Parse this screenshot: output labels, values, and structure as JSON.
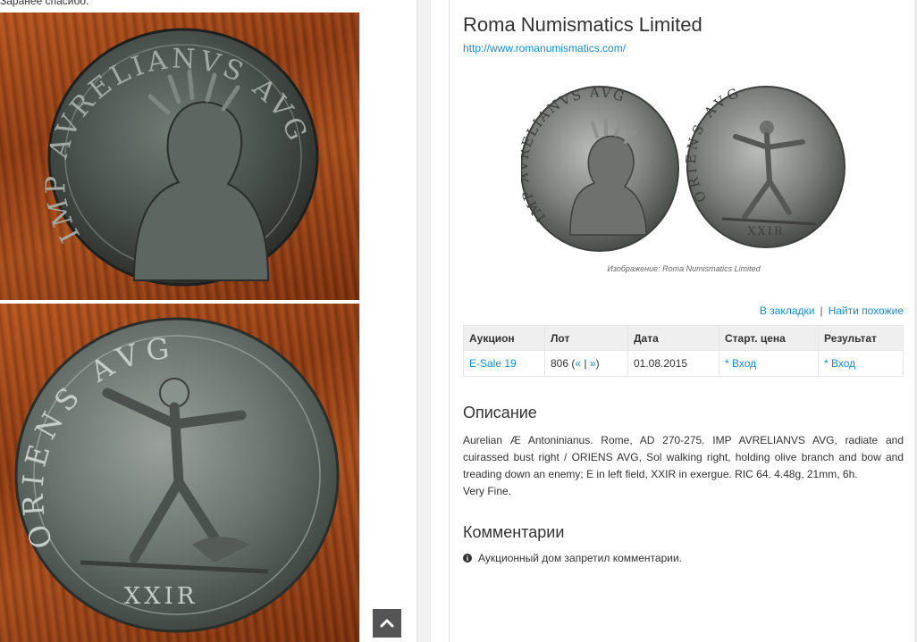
{
  "left": {
    "top_text": "Заранее спасибо.",
    "photo_obverse_legend": "IMP AVRELIANVS AVG",
    "photo_reverse_legend": "ORIENS AVG",
    "photo_reverse_exergue": "XXIR"
  },
  "header": {
    "title": "Roma Numismatics Limited",
    "url": "http://www.romanumismatics.com/"
  },
  "image": {
    "caption": "Изображение: Roma Numismatics Limited"
  },
  "actions": {
    "bookmarks": "В закладки",
    "separator": "|",
    "find_similar": "Найти похожие"
  },
  "table": {
    "headers": [
      "Аукцион",
      "Лот",
      "Дата",
      "Старт. цена",
      "Результат"
    ],
    "row": {
      "auction": "E-Sale 19",
      "lot": "806",
      "lot_prev": "«",
      "lot_sep": "|",
      "lot_next": "»",
      "date": "01.08.2015",
      "start_price": "* Вход",
      "result": "* Вход"
    }
  },
  "description": {
    "heading": "Описание",
    "text": "Aurelian Æ Antoninianus. Rome, AD 270-275. IMP AVRELIANVS AVG, radiate and cuirassed bust right / ORIENS AVG, Sol walking right, holding olive branch and bow and treading down an enemy; E in left field, XXIR in exergue. RIC 64. 4.48g, 21mm, 6h.",
    "grade": "Very Fine."
  },
  "comments": {
    "heading": "Комментарии",
    "note": "Аукционный дом запретил комментарии."
  },
  "icons": {
    "scroll_top": "chevron-up-icon",
    "info": "info-circle-icon"
  },
  "colors": {
    "link": "#1a8ad0",
    "header_bg": "#efefef"
  }
}
